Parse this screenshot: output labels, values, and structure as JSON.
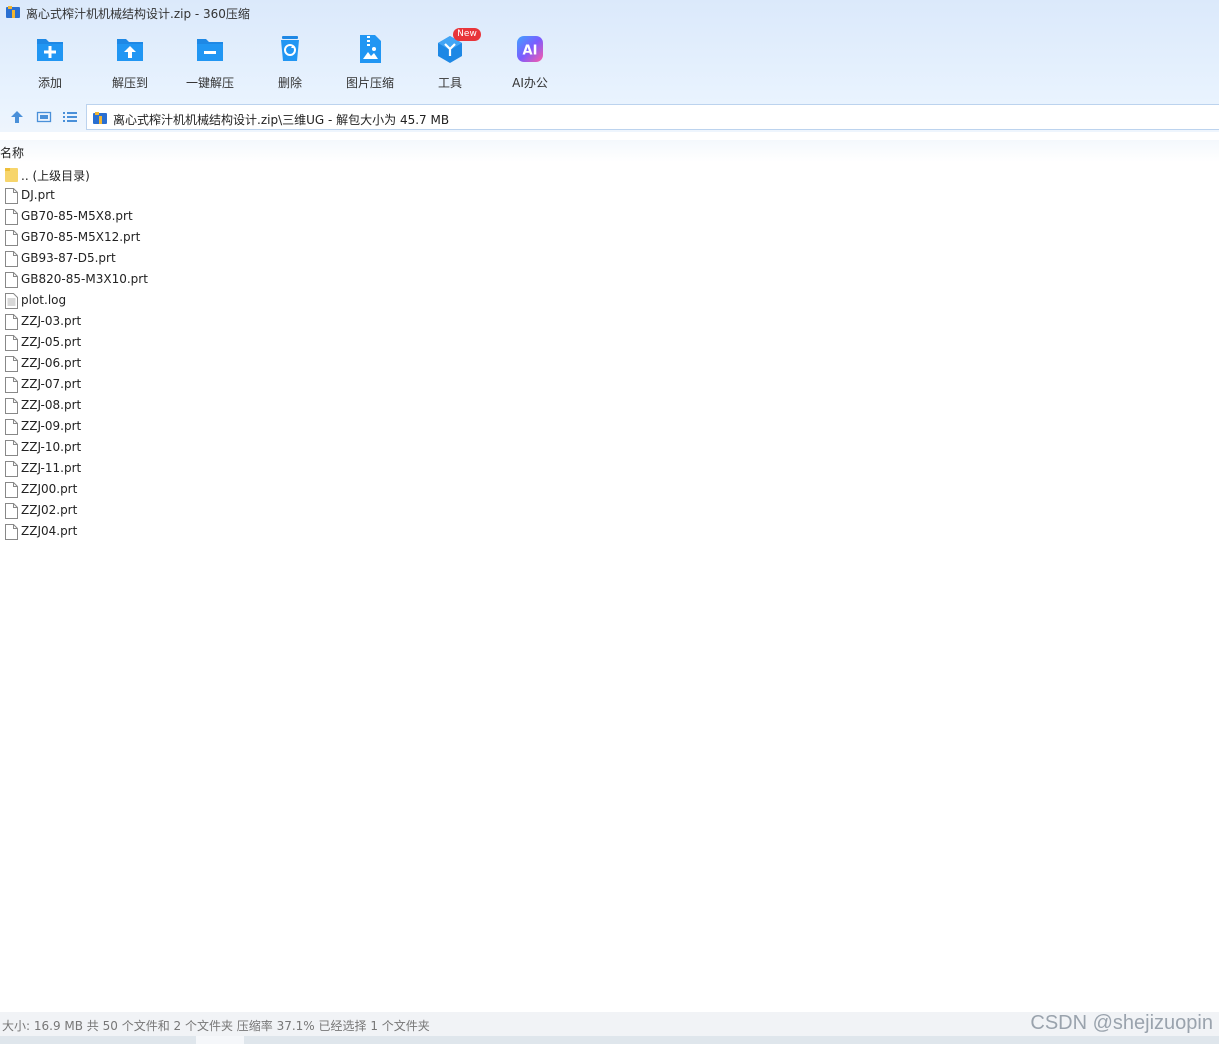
{
  "window": {
    "title": "离心式榨汁机机械结构设计.zip - 360压缩"
  },
  "toolbar": {
    "items": [
      {
        "label": "添加",
        "icon": "add-folder-icon"
      },
      {
        "label": "解压到",
        "icon": "extract-to-icon"
      },
      {
        "label": "一键解压",
        "icon": "one-click-extract-icon"
      },
      {
        "label": "删除",
        "icon": "recycle-icon"
      },
      {
        "label": "图片压缩",
        "icon": "image-compress-icon"
      },
      {
        "label": "工具",
        "icon": "tools-cube-icon",
        "badge": "New"
      },
      {
        "label": "AI办公",
        "icon": "ai-icon",
        "icon_text": "AI"
      }
    ]
  },
  "address": {
    "path": "离心式榨汁机机械结构设计.zip\\三维UG - 解包大小为 45.7 MB"
  },
  "list": {
    "column_name": "名称",
    "files": [
      {
        "name": ".. (上级目录)",
        "type": "folder"
      },
      {
        "name": "DJ.prt",
        "type": "file"
      },
      {
        "name": "GB70-85-M5X8.prt",
        "type": "file"
      },
      {
        "name": "GB70-85-M5X12.prt",
        "type": "file"
      },
      {
        "name": "GB93-87-D5.prt",
        "type": "file"
      },
      {
        "name": "GB820-85-M3X10.prt",
        "type": "file"
      },
      {
        "name": "plot.log",
        "type": "text"
      },
      {
        "name": "ZZJ-03.prt",
        "type": "file"
      },
      {
        "name": "ZZJ-05.prt",
        "type": "file"
      },
      {
        "name": "ZZJ-06.prt",
        "type": "file"
      },
      {
        "name": "ZZJ-07.prt",
        "type": "file"
      },
      {
        "name": "ZZJ-08.prt",
        "type": "file"
      },
      {
        "name": "ZZJ-09.prt",
        "type": "file"
      },
      {
        "name": "ZZJ-10.prt",
        "type": "file"
      },
      {
        "name": "ZZJ-11.prt",
        "type": "file"
      },
      {
        "name": "ZZJ00.prt",
        "type": "file"
      },
      {
        "name": "ZZJ02.prt",
        "type": "file"
      },
      {
        "name": "ZZJ04.prt",
        "type": "file"
      }
    ]
  },
  "status": {
    "text": "大小: 16.9 MB 共 50 个文件和 2 个文件夹 压缩率 37.1% 已经选择 1 个文件夹",
    "watermark": "CSDN @shejizuopin"
  },
  "colors": {
    "accent": "#1e88e5",
    "folder": "#f7d56b",
    "badge": "#e8353a"
  }
}
